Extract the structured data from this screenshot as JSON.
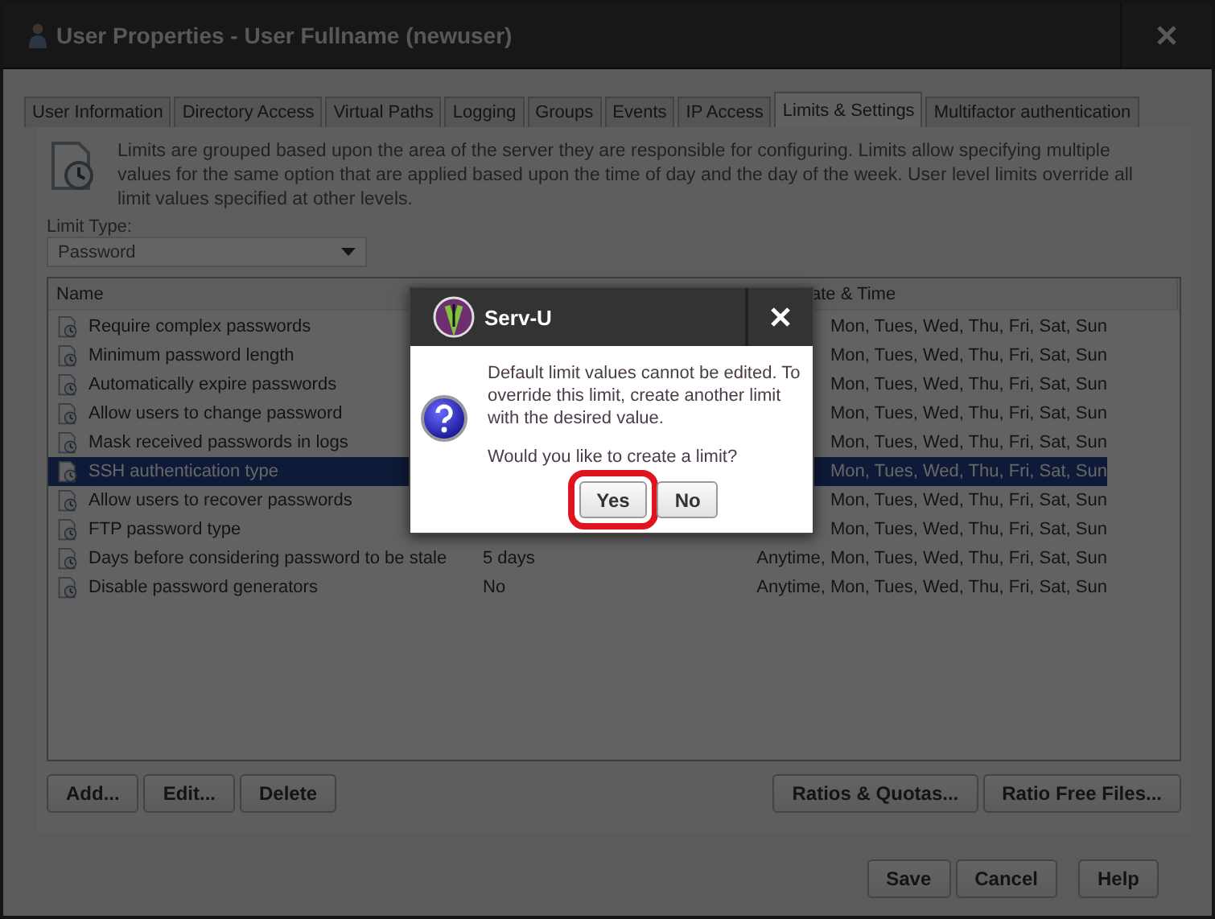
{
  "window": {
    "title": "User Properties - User Fullname (newuser)"
  },
  "tabs": [
    {
      "label": "User Information",
      "selected": false
    },
    {
      "label": "Directory Access",
      "selected": false
    },
    {
      "label": "Virtual Paths",
      "selected": false
    },
    {
      "label": "Logging",
      "selected": false
    },
    {
      "label": "Groups",
      "selected": false
    },
    {
      "label": "Events",
      "selected": false
    },
    {
      "label": "IP Access",
      "selected": false
    },
    {
      "label": "Limits & Settings",
      "selected": true
    },
    {
      "label": "Multifactor authentication",
      "selected": false
    }
  ],
  "description": "Limits are grouped based upon the area of the server they are responsible for configuring. Limits allow specifying multiple values for the same option that are applied based upon the time of day and the day of the week. User level limits override all limit values specified at other levels.",
  "limit_type": {
    "label": "Limit Type:",
    "value": "Password"
  },
  "table": {
    "columns": [
      "Name",
      "ate & Time"
    ],
    "rows": [
      {
        "name": "Require complex passwords",
        "date": "Mon, Tues, Wed, Thu, Fri, Sat, Sun",
        "selected": false
      },
      {
        "name": "Minimum password length",
        "date": "Mon, Tues, Wed, Thu, Fri, Sat, Sun",
        "selected": false
      },
      {
        "name": "Automatically expire passwords",
        "date": "Mon, Tues, Wed, Thu, Fri, Sat, Sun",
        "selected": false
      },
      {
        "name": "Allow users to change password",
        "date": "Mon, Tues, Wed, Thu, Fri, Sat, Sun",
        "selected": false
      },
      {
        "name": "Mask received passwords in logs",
        "date": "Mon, Tues, Wed, Thu, Fri, Sat, Sun",
        "selected": false
      },
      {
        "name": "SSH authentication type",
        "date": "Mon, Tues, Wed, Thu, Fri, Sat, Sun",
        "selected": true
      },
      {
        "name": "Allow users to recover passwords",
        "date": "Mon, Tues, Wed, Thu, Fri, Sat, Sun",
        "selected": false
      },
      {
        "name": "FTP password type",
        "date": "Mon, Tues, Wed, Thu, Fri, Sat, Sun",
        "selected": false
      },
      {
        "name": "Days before considering password to be stale",
        "value": "5 days",
        "date": "Anytime, Mon, Tues, Wed, Thu, Fri, Sat, Sun",
        "selected": false
      },
      {
        "name": "Disable password generators",
        "value": "No",
        "date": "Anytime, Mon, Tues, Wed, Thu, Fri, Sat, Sun",
        "selected": false
      }
    ]
  },
  "list_buttons": [
    "Add...",
    "Edit...",
    "Delete"
  ],
  "ratio_buttons": [
    "Ratios & Quotas...",
    "Ratio Free Files..."
  ],
  "footer_buttons": [
    "Save",
    "Cancel",
    "Help"
  ],
  "dialog": {
    "title": "Serv-U",
    "message": [
      "Default limit values cannot be edited. To override this limit, create another limit with the desired value.",
      "Would you like to create a limit?"
    ],
    "buttons": [
      {
        "label": "Yes",
        "highlighted": true
      },
      {
        "label": "No",
        "highlighted": false
      }
    ]
  }
}
